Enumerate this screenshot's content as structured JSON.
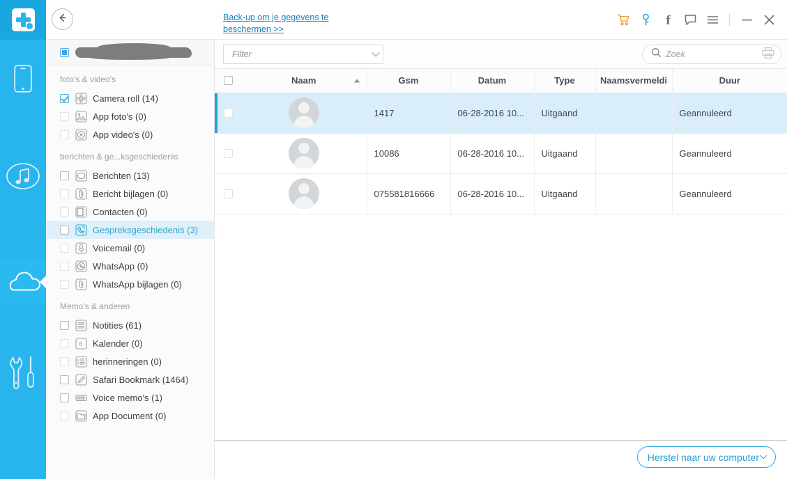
{
  "app": {
    "logo_icon": "medical-cross-logo",
    "back_icon": "back-arrow-icon"
  },
  "rail": {
    "items": [
      {
        "name": "phone",
        "icon": "phone-icon",
        "active": false
      },
      {
        "name": "music",
        "icon": "music-note-icon",
        "active": false
      },
      {
        "name": "cloud",
        "icon": "cloud-icon",
        "active": true
      },
      {
        "name": "tools",
        "icon": "wrench-screwdriver-icon",
        "active": false
      }
    ]
  },
  "topbar": {
    "promo_link": "Back-up om je gegevens te beschermen >>",
    "icons": [
      {
        "name": "cart-icon",
        "glyph": "cart",
        "color": "#f0a030"
      },
      {
        "name": "key-icon",
        "glyph": "key",
        "color": "#33aee8"
      },
      {
        "name": "facebook-icon",
        "glyph": "f",
        "color": "#6d7276"
      },
      {
        "name": "message-icon",
        "glyph": "message",
        "color": "#6d7276"
      },
      {
        "name": "menu-icon",
        "glyph": "hamburger",
        "color": "#6d7276"
      },
      {
        "name": "minimize-icon",
        "glyph": "minus",
        "color": "#6d7276"
      },
      {
        "name": "close-icon",
        "glyph": "x",
        "color": "#6d7276"
      }
    ]
  },
  "sidebar": {
    "device_name_redacted": true,
    "device_checkbox_state": "partial",
    "sections": [
      {
        "heading": "foto's & video's",
        "items": [
          {
            "label": "Camera roll (14)",
            "icon": "flower-icon",
            "checked": true,
            "selected": false
          },
          {
            "label": "App foto's (0)",
            "icon": "image-icon",
            "checked": false,
            "selected": false,
            "faint": true
          },
          {
            "label": "App video's (0)",
            "icon": "play-icon",
            "checked": false,
            "selected": false,
            "faint": true
          }
        ]
      },
      {
        "heading": "berichten & ge...ksgeschiedenis",
        "items": [
          {
            "label": "Berichten (13)",
            "icon": "message-bubble-icon",
            "checked": false,
            "selected": false
          },
          {
            "label": "Bericht bijlagen (0)",
            "icon": "paperclip-icon",
            "checked": false,
            "selected": false,
            "faint": true
          },
          {
            "label": "Contacten (0)",
            "icon": "contacts-icon",
            "checked": false,
            "selected": false,
            "faint": true
          },
          {
            "label": "Gespreksgeschiedenis (3)",
            "icon": "call-history-icon",
            "checked": false,
            "selected": true
          },
          {
            "label": "Voicemail (0)",
            "icon": "microphone-icon",
            "checked": false,
            "selected": false,
            "faint": true
          },
          {
            "label": "WhatsApp (0)",
            "icon": "whatsapp-icon",
            "checked": false,
            "selected": false,
            "faint": true
          },
          {
            "label": "WhatsApp bijlagen (0)",
            "icon": "paperclip-icon",
            "checked": false,
            "selected": false,
            "faint": true
          }
        ]
      },
      {
        "heading": "Memo's & anderen",
        "items": [
          {
            "label": "Notities (61)",
            "icon": "notes-icon",
            "checked": false,
            "selected": false
          },
          {
            "label": "Kalender (0)",
            "icon": "calendar-icon",
            "checked": false,
            "selected": false,
            "faint": true
          },
          {
            "label": "herinneringen (0)",
            "icon": "reminders-icon",
            "checked": false,
            "selected": false,
            "faint": true
          },
          {
            "label": "Safari Bookmark (1464)",
            "icon": "bookmark-pen-icon",
            "checked": false,
            "selected": false
          },
          {
            "label": "Voice memo's (1)",
            "icon": "waveform-icon",
            "checked": false,
            "selected": false
          },
          {
            "label": "App Document (0)",
            "icon": "folder-icon",
            "checked": false,
            "selected": false,
            "faint": true
          }
        ]
      }
    ]
  },
  "main": {
    "filter": {
      "placeholder": "Filter",
      "value": "",
      "icon": "chevron-down-icon"
    },
    "search": {
      "placeholder": "Zoek",
      "value": "",
      "icon": "search-icon"
    },
    "print_icon": "printer-icon",
    "table": {
      "columns": [
        {
          "key": "chk",
          "label": ""
        },
        {
          "key": "name",
          "label": "Naam",
          "sort": "asc"
        },
        {
          "key": "gsm",
          "label": "Gsm"
        },
        {
          "key": "date",
          "label": "Datum"
        },
        {
          "key": "type",
          "label": "Type"
        },
        {
          "key": "nv",
          "label": "Naamsvermeldi"
        },
        {
          "key": "dur",
          "label": "Duur"
        }
      ],
      "rows": [
        {
          "checked": false,
          "selected": true,
          "avatar": "default-avatar",
          "name": "",
          "gsm": "1417",
          "date": "06-28-2016 10...",
          "type": "Uitgaand",
          "nv": "",
          "dur": "Geannuleerd"
        },
        {
          "checked": false,
          "selected": false,
          "avatar": "default-avatar",
          "name": "",
          "gsm": "10086",
          "date": "06-28-2016 10...",
          "type": "Uitgaand",
          "nv": "",
          "dur": "Geannuleerd"
        },
        {
          "checked": false,
          "selected": false,
          "avatar": "default-avatar",
          "name": "",
          "gsm": "075581816666",
          "date": "06-28-2016 10...",
          "type": "Uitgaand",
          "nv": "",
          "dur": "Geannuleerd"
        }
      ]
    },
    "footer": {
      "restore_label": "Herstel naar uw computer",
      "restore_icon": "chevron-down-icon"
    }
  },
  "colors": {
    "brand_blue": "#28b4ec",
    "accent_teal": "#2fa8c9",
    "row_selected": "#d9eefa",
    "link": "#1b7fb5"
  }
}
